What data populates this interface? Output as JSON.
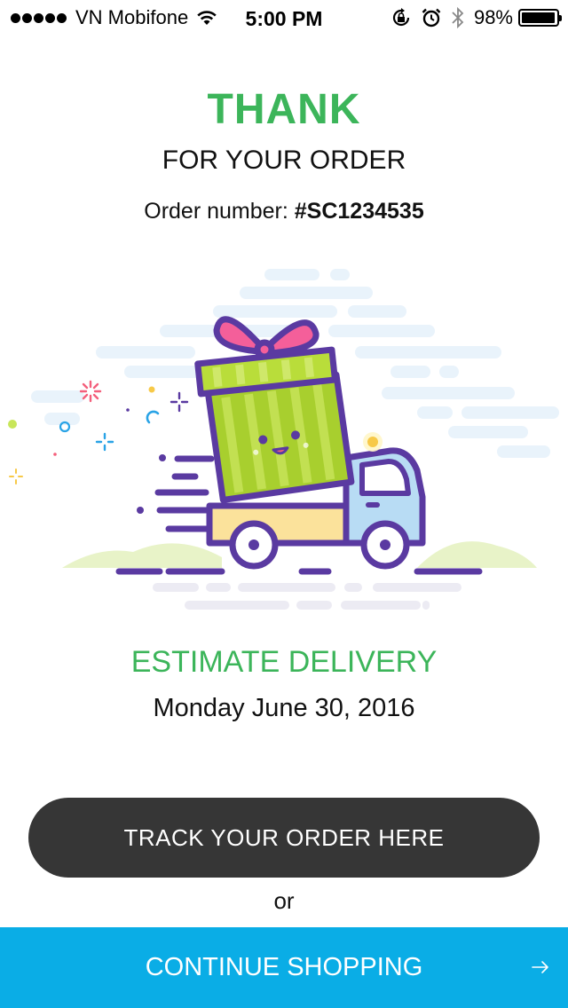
{
  "status_bar": {
    "carrier": "VN Mobifone",
    "time": "5:00 PM",
    "battery_percent": "98%",
    "battery_level": 0.98,
    "icons": [
      "signal-dots",
      "wifi-icon",
      "rotation-lock-icon",
      "alarm-icon",
      "bluetooth-icon",
      "battery-icon"
    ]
  },
  "header": {
    "title": "THANK",
    "subtitle": "FOR YOUR ORDER",
    "order_label": "Order number:",
    "order_number": "#SC1234535"
  },
  "illustration": {
    "icon": "delivery-truck-gift-illustration"
  },
  "delivery": {
    "title": "ESTIMATE DELIVERY",
    "date": "Monday June 30, 2016"
  },
  "actions": {
    "track_label": "TRACK YOUR ORDER HERE",
    "or_label": "or",
    "continue_label": "CONTINUE SHOPPING",
    "continue_icon": "arrow-right-icon"
  },
  "colors": {
    "accent_green": "#3cb55a",
    "track_button_bg": "#363636",
    "continue_button_bg": "#0aade6"
  }
}
